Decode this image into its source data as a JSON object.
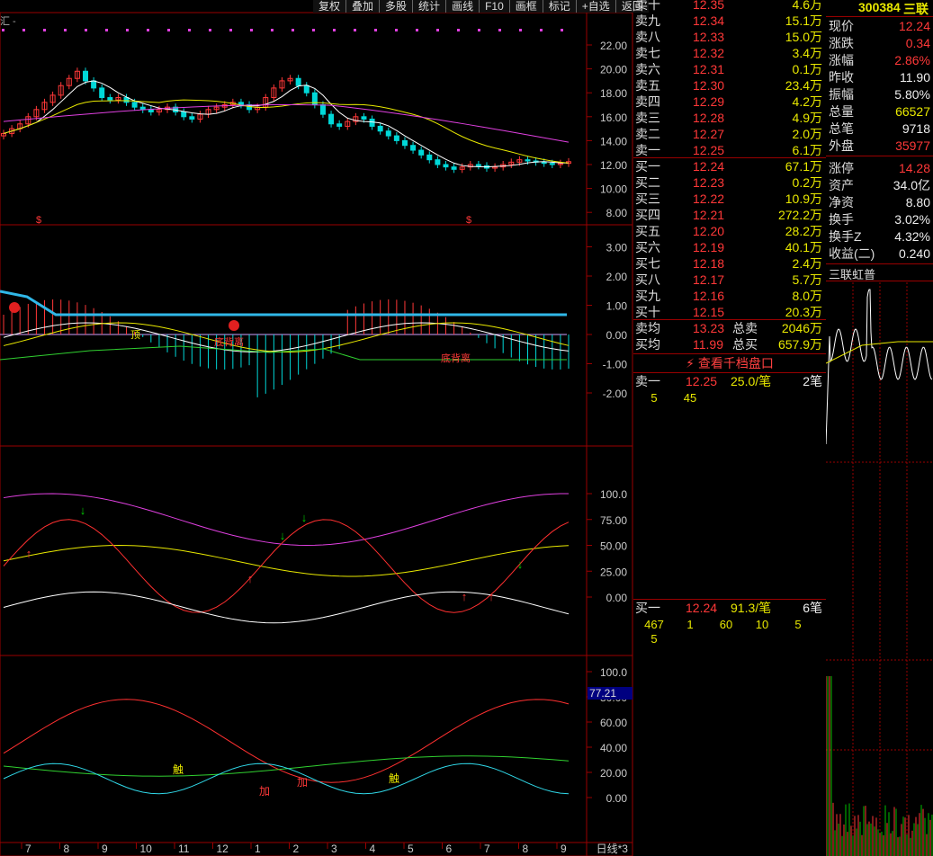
{
  "toolbar": [
    "复权",
    "叠加",
    "多股",
    "统计",
    "画线",
    "F10",
    "画框",
    "标记",
    "+自选",
    "返回"
  ],
  "title_stub": "汇 -",
  "main_price_axis": [
    "22.00",
    "20.00",
    "18.00",
    "16.00",
    "14.00",
    "12.00",
    "10.00",
    "8.00"
  ],
  "macd_axis": [
    "3.00",
    "2.00",
    "1.00",
    "0.00",
    "-1.00",
    "-2.00"
  ],
  "kdj_axis": [
    "100.0",
    "75.00",
    "50.00",
    "25.00",
    "0.00"
  ],
  "rsi_axis": [
    "100.0",
    "80.00",
    "60.00",
    "40.00",
    "20.00",
    "0.00"
  ],
  "rsi_current": "77.21",
  "x_dates": [
    "7",
    "8",
    "9",
    "10",
    "11",
    "12",
    "1",
    "2",
    "3",
    "4",
    "5",
    "6",
    "7",
    "8",
    "9"
  ],
  "period_label": "日线*3",
  "annotations": {
    "bottom_divergence": "底背离",
    "chu_ji": "触",
    "jia": "加",
    "ding": "顶"
  },
  "stock": {
    "code": "300384",
    "name": "三联"
  },
  "quote": [
    {
      "label": "现价",
      "value": "12.24",
      "color": "red"
    },
    {
      "label": "涨跌",
      "value": "0.34",
      "color": "red"
    },
    {
      "label": "涨幅",
      "value": "2.86%",
      "color": "red"
    },
    {
      "label": "昨收",
      "value": "11.90",
      "color": "white"
    },
    {
      "label": "振幅",
      "value": "5.80%",
      "color": "white"
    },
    {
      "label": "总量",
      "value": "66527",
      "color": "yel"
    },
    {
      "label": "总笔",
      "value": "9718",
      "color": "white"
    },
    {
      "label": "外盘",
      "value": "35977",
      "color": "red"
    },
    {
      "label": "涨停",
      "value": "14.28",
      "color": "red"
    },
    {
      "label": "资产",
      "value": "34.0亿",
      "color": "white"
    },
    {
      "label": "净资",
      "value": "8.80",
      "color": "white"
    },
    {
      "label": "换手",
      "value": "3.02%",
      "color": "white"
    },
    {
      "label": "换手Z",
      "value": "4.32%",
      "color": "white"
    },
    {
      "label": "收益(二)",
      "value": "0.240",
      "color": "white"
    }
  ],
  "mini_chart_title": "三联虹普",
  "sell_levels": [
    {
      "label": "卖十",
      "price": "12.35",
      "vol": "4.6万"
    },
    {
      "label": "卖九",
      "price": "12.34",
      "vol": "15.1万"
    },
    {
      "label": "卖八",
      "price": "12.33",
      "vol": "15.0万"
    },
    {
      "label": "卖七",
      "price": "12.32",
      "vol": "3.4万"
    },
    {
      "label": "卖六",
      "price": "12.31",
      "vol": "0.1万"
    },
    {
      "label": "卖五",
      "price": "12.30",
      "vol": "23.4万"
    },
    {
      "label": "卖四",
      "price": "12.29",
      "vol": "4.2万"
    },
    {
      "label": "卖三",
      "price": "12.28",
      "vol": "4.9万"
    },
    {
      "label": "卖二",
      "price": "12.27",
      "vol": "2.0万"
    },
    {
      "label": "卖一",
      "price": "12.25",
      "vol": "6.1万"
    }
  ],
  "buy_levels": [
    {
      "label": "买一",
      "price": "12.24",
      "vol": "67.1万"
    },
    {
      "label": "买二",
      "price": "12.23",
      "vol": "0.2万"
    },
    {
      "label": "买三",
      "price": "12.22",
      "vol": "10.9万"
    },
    {
      "label": "买四",
      "price": "12.21",
      "vol": "272.2万"
    },
    {
      "label": "买五",
      "price": "12.20",
      "vol": "28.2万"
    },
    {
      "label": "买六",
      "price": "12.19",
      "vol": "40.1万"
    },
    {
      "label": "买七",
      "price": "12.18",
      "vol": "2.4万"
    },
    {
      "label": "买八",
      "price": "12.17",
      "vol": "5.7万"
    },
    {
      "label": "买九",
      "price": "12.16",
      "vol": "8.0万"
    },
    {
      "label": "买十",
      "price": "12.15",
      "vol": "20.3万"
    }
  ],
  "avg": {
    "sell_avg_label": "卖均",
    "sell_avg": "13.23",
    "total_sell_label": "总卖",
    "total_sell": "2046万",
    "buy_avg_label": "买均",
    "buy_avg": "11.99",
    "total_buy_label": "总买",
    "total_buy": "657.9万"
  },
  "depth_button": "查看千档盘口",
  "sell1_queue": {
    "label": "卖一",
    "price": "12.25",
    "size": "25.0/笔",
    "count": "2笔",
    "orders": [
      "5",
      "45"
    ]
  },
  "buy1_queue": {
    "label": "买一",
    "price": "12.24",
    "size": "91.3/笔",
    "count": "6笔",
    "orders": [
      "467",
      "1",
      "60",
      "10",
      "5",
      "5"
    ]
  },
  "colors": {
    "up": "#ff3838",
    "down": "#00d8d8",
    "grid": "#8b0000",
    "axis_text": "#cccccc"
  }
}
